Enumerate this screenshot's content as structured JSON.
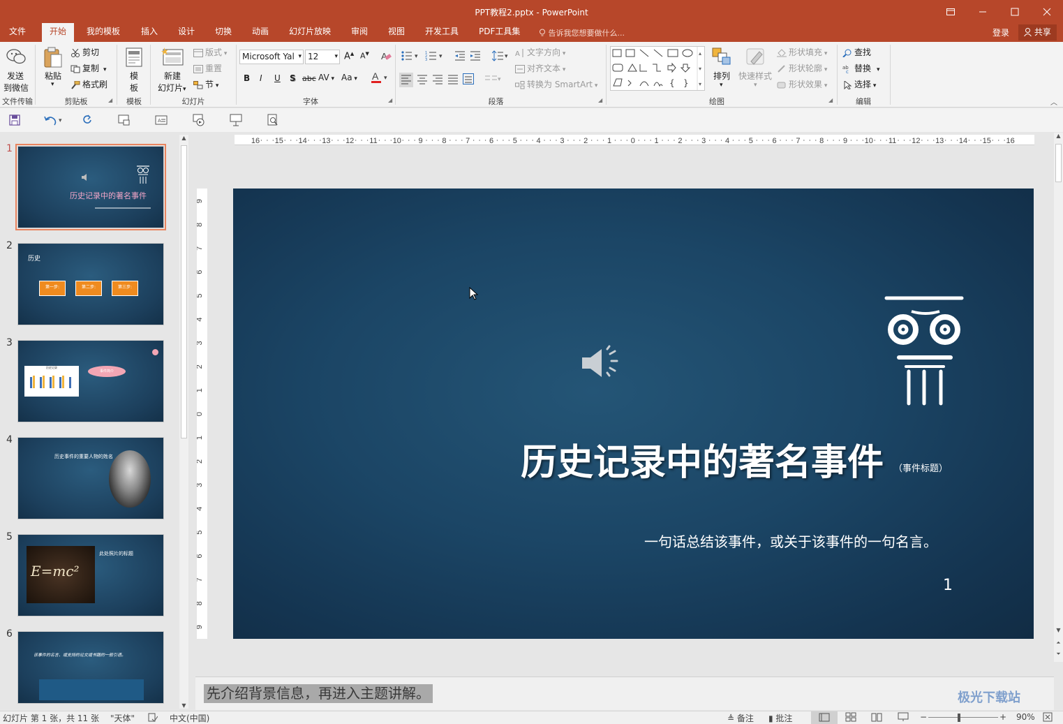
{
  "window": {
    "title": "PPT教程2.pptx - PowerPoint"
  },
  "menu": {
    "tabs": [
      "文件",
      "开始",
      "我的模板",
      "插入",
      "设计",
      "切换",
      "动画",
      "幻灯片放映",
      "审阅",
      "视图",
      "开发工具",
      "PDF工具集"
    ],
    "active_tab": "开始",
    "tell_me": "告诉我您想要做什么...",
    "login": "登录",
    "share": "共享"
  },
  "ribbon": {
    "file_transfer": {
      "send": "发送",
      "to_wechat": "到微信",
      "group": "文件传输"
    },
    "clipboard": {
      "paste": "粘贴",
      "cut": "剪切",
      "copy": "复制",
      "format_painter": "格式刷",
      "group": "剪贴板"
    },
    "template": {
      "btn_line1": "模",
      "btn_line2": "板",
      "group": "模板"
    },
    "slides": {
      "new_line1": "新建",
      "new_line2": "幻灯片",
      "layout": "版式",
      "reset": "重置",
      "section": "节",
      "group": "幻灯片"
    },
    "font": {
      "name": "Microsoft Yal",
      "size": "12",
      "group": "字体"
    },
    "paragraph": {
      "text_direction": "文字方向",
      "align_text": "对齐文本",
      "convert_smartart": "转换为 SmartArt",
      "group": "段落"
    },
    "drawing": {
      "arrange": "排列",
      "quick_styles": "快速样式",
      "shape_fill": "形状填充",
      "shape_outline": "形状轮廓",
      "shape_effects": "形状效果",
      "group": "绘图"
    },
    "editing": {
      "find": "查找",
      "replace": "替换",
      "select": "选择",
      "group": "编辑"
    }
  },
  "rulers": {
    "horizontal": [
      "16",
      "15",
      "14",
      "13",
      "12",
      "11",
      "10",
      "9",
      "8",
      "7",
      "6",
      "5",
      "4",
      "3",
      "2",
      "1",
      "0",
      "1",
      "2",
      "3",
      "4",
      "5",
      "6",
      "7",
      "8",
      "9",
      "10",
      "11",
      "12",
      "13",
      "14",
      "15",
      "16"
    ],
    "vertical": [
      "9",
      "8",
      "7",
      "6",
      "5",
      "4",
      "3",
      "2",
      "1",
      "0",
      "1",
      "2",
      "3",
      "4",
      "5",
      "6",
      "7",
      "8",
      "9"
    ]
  },
  "thumbnails": [
    {
      "num": "1",
      "title": "历史记录中的著名事件",
      "selected": true
    },
    {
      "num": "2",
      "title": "历史",
      "steps": [
        "第一步:",
        "第二步:",
        "第三步:"
      ]
    },
    {
      "num": "3",
      "chart_title": "历史记录",
      "bubble": "事件简介"
    },
    {
      "num": "4",
      "title": "历史事件的重要人物的姓名"
    },
    {
      "num": "5",
      "title": "此处照片的标题",
      "formula": "E=mc²"
    },
    {
      "num": "6",
      "quote": "该事件的名言、或支持的论文或书籍的一般引语。"
    }
  ],
  "slide": {
    "title": "历史记录中的著名事件",
    "title_note": "（事件标题）",
    "subtitle": "一句话总结该事件，或关于该事件的一句名言。",
    "number": "1"
  },
  "notes": {
    "text": "先介绍背景信息，再进入主题讲解。"
  },
  "status": {
    "slide_info": "幻灯片 第 1 张，共 11 张",
    "theme": "\"天体\"",
    "language": "中文(中国)",
    "notes_btn": "备注",
    "comments_btn": "批注",
    "zoom": "90%"
  },
  "watermark": "极光下载站",
  "colors": {
    "accent": "#b7472a",
    "slide_bg": "#1b4565"
  }
}
